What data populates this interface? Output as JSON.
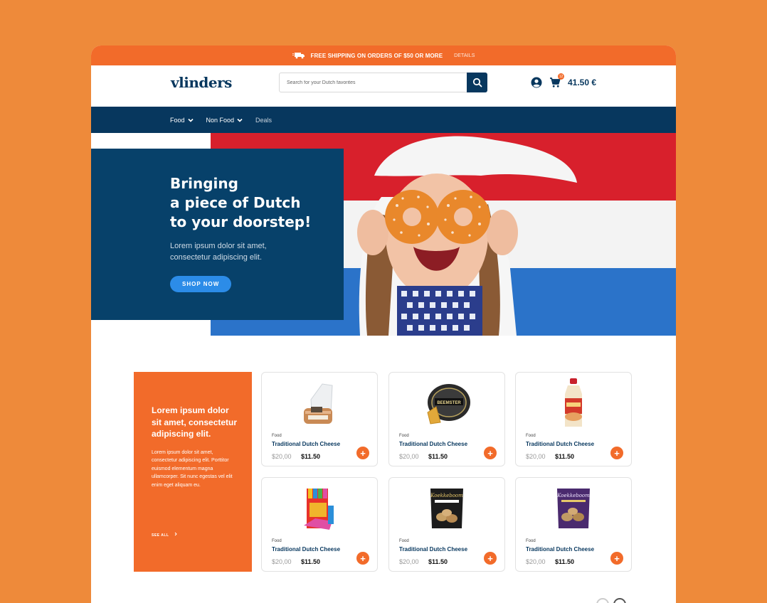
{
  "promo_bar": {
    "text": "FREE SHIPPING ON ORDERS OF $50 OR MORE",
    "details": "DETAILS"
  },
  "header": {
    "logo": "vlinders",
    "search_placeholder": "Search for your Dutch favorites",
    "cart_count": "12",
    "cart_total": "41.50 €"
  },
  "nav": {
    "items": [
      "Food",
      "Non Food",
      "Deals"
    ]
  },
  "hero": {
    "title": "Bringing\na piece of Dutch\nto your doorstep!",
    "subtitle": "Lorem ipsum dolor sit amet,\nconsectetur adipiscing elit.",
    "button": "SHOP NOW"
  },
  "promo_card": {
    "title": "Lorem ipsum dolor sit amet, consectetur adipiscing elit.",
    "body": "Lorem ipsum dolor sit amet, consectetur adipiscing elit. Porttitor euismod elementum magna ullamcorper. Sit nunc egestas vel elit enim eget aliquam eu.",
    "link": "SEE ALL"
  },
  "products": [
    {
      "category": "Food",
      "name": "Traditional Dutch Cheese",
      "old_price": "$20,00",
      "price": "$11.50",
      "image": "bread-bag"
    },
    {
      "category": "Food",
      "name": "Traditional Dutch Cheese",
      "old_price": "$20,00",
      "price": "$11.50",
      "image": "cheese-wheel",
      "brand": "BEEMSTER"
    },
    {
      "category": "Food",
      "name": "Traditional Dutch Cheese",
      "old_price": "$20,00",
      "price": "$11.50",
      "image": "sauce-bottle"
    },
    {
      "category": "Food",
      "name": "Traditional Dutch Cheese",
      "old_price": "$20,00",
      "price": "$11.50",
      "image": "candy-box"
    },
    {
      "category": "Food",
      "name": "Traditional Dutch Cheese",
      "old_price": "$20,00",
      "price": "$11.50",
      "image": "snack-bag-black",
      "brand": "Koekkeboom"
    },
    {
      "category": "Food",
      "name": "Traditional Dutch Cheese",
      "old_price": "$20,00",
      "price": "$11.50",
      "image": "snack-bag-purple",
      "brand": "Koekkeboom"
    }
  ],
  "add_label": "+",
  "colors": {
    "brand_orange": "#F26B2A",
    "navy": "#07375E",
    "cta_blue": "#2C8CE8",
    "background": "#EE8A3A"
  }
}
